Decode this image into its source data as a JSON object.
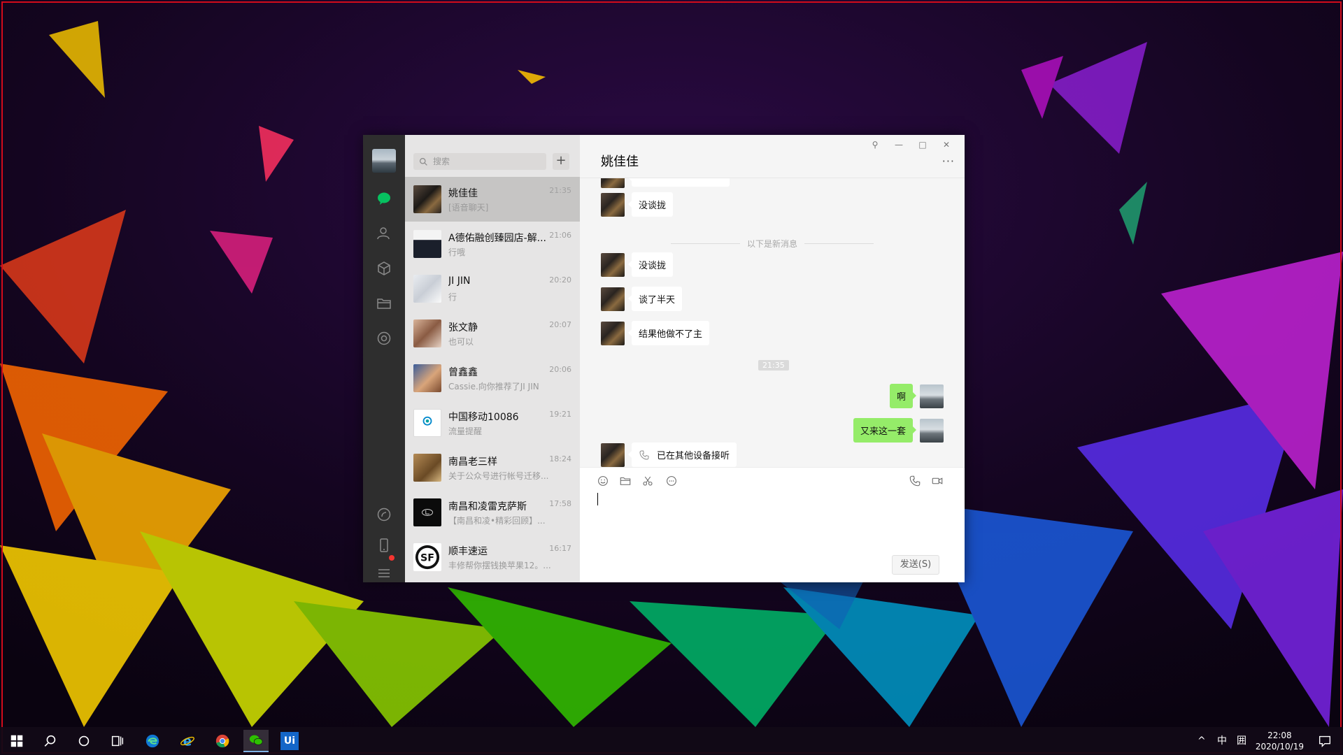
{
  "window": {
    "search_placeholder": "搜索",
    "add_label": "+",
    "controls": {
      "pin": "⚲",
      "minimize": "—",
      "maximize": "□",
      "close": "✕"
    }
  },
  "nav": {
    "icons": [
      "avatar",
      "chat-icon",
      "contacts-icon",
      "favorites-icon",
      "files-icon",
      "moments-icon",
      "mini-program-icon",
      "phone-icon",
      "menu-icon"
    ],
    "accent": "#07c160"
  },
  "conversations": [
    {
      "name": "姚佳佳",
      "time": "21:35",
      "preview": "[语音聊天]"
    },
    {
      "name": "A德佑融创臻园店-解...",
      "time": "21:06",
      "preview": "行哦"
    },
    {
      "name": "JI JIN",
      "time": "20:20",
      "preview": "行"
    },
    {
      "name": "张文静",
      "time": "20:07",
      "preview": "也可以"
    },
    {
      "name": "曾鑫鑫",
      "time": "20:06",
      "preview": "Cassie.向你推荐了JI JIN"
    },
    {
      "name": "中国移动10086",
      "time": "19:21",
      "preview": "流量提醒"
    },
    {
      "name": "南昌老三样",
      "time": "18:24",
      "preview": "关于公众号进行帐号迁移..."
    },
    {
      "name": "南昌和凌雷克萨斯",
      "time": "17:58",
      "preview": "【南昌和凌•精彩回顾】..."
    },
    {
      "name": "顺丰速运",
      "time": "16:17",
      "preview": "丰修帮你摆钱换苹果12。..."
    }
  ],
  "chat": {
    "title": "姚佳佳",
    "more": "···",
    "divider_text": "以下是新消息",
    "time_badge": "21:35",
    "messages": [
      {
        "side": "left",
        "text": "没谈拢"
      },
      {
        "side": "left",
        "text": "没谈拢"
      },
      {
        "side": "left",
        "text": "谈了半天"
      },
      {
        "side": "left",
        "text": "结果他做不了主"
      },
      {
        "side": "right",
        "text": "啊"
      },
      {
        "side": "right",
        "text": "又来这一套"
      },
      {
        "side": "left",
        "text": "已在其他设备接听"
      }
    ],
    "send_label": "发送(S)",
    "accent_bubble": "#95ec69"
  },
  "taskbar": {
    "apps": [
      "windows-start-icon",
      "search-icon",
      "cortana-icon",
      "task-view-icon",
      "edge-icon",
      "ie-icon",
      "chrome-icon",
      "wechat-icon",
      "uipath-icon"
    ],
    "uipath_label": "Ui",
    "tray_caret": "^",
    "ime": "中",
    "ime2": "囲",
    "time": "22:08",
    "date": "2020/10/19"
  }
}
